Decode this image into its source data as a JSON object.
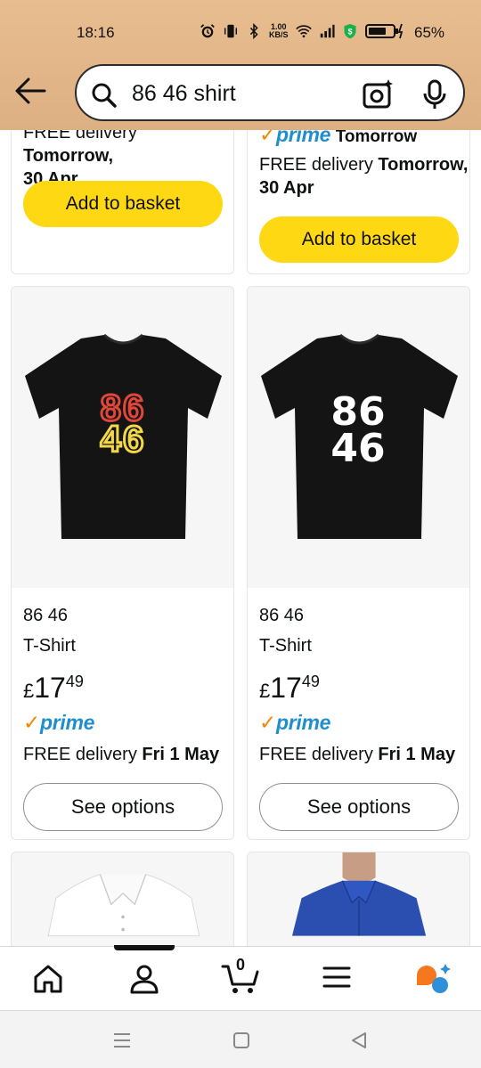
{
  "status_bar": {
    "time": "18:16",
    "network_speed_value": "1.00",
    "network_speed_unit": "KB/S",
    "battery": "65%"
  },
  "search": {
    "query": "86 46 shirt"
  },
  "cards_top": [
    {
      "delivery_prefix": "FREE delivery",
      "delivery_day": "Tomorrow,",
      "delivery_date": "30 Apr",
      "button": "Add to basket"
    },
    {
      "prime_label": "prime",
      "prime_delivery": "Tomorrow",
      "delivery_prefix": "FREE delivery",
      "delivery_day": "Tomorrow,",
      "delivery_date": "30 Apr",
      "button": "Add to basket"
    }
  ],
  "products": [
    {
      "title_line1": "86 46",
      "title_line2": "T-Shirt",
      "price_currency": "£",
      "price_whole": "17",
      "price_fraction": "49",
      "prime_label": "prime",
      "delivery_prefix": "FREE delivery",
      "delivery_date": "Fri 1 May",
      "button": "See options",
      "shirt_print_line1": "86",
      "shirt_print_line2": "46"
    },
    {
      "title_line1": "86 46",
      "title_line2": "T-Shirt",
      "price_currency": "£",
      "price_whole": "17",
      "price_fraction": "49",
      "prime_label": "prime",
      "delivery_prefix": "FREE delivery",
      "delivery_date": "Fri 1 May",
      "button": "See options",
      "shirt_print_line1": "86",
      "shirt_print_line2": "46"
    }
  ],
  "bottom_nav": {
    "cart_count": "0",
    "items": [
      "home-icon",
      "account-icon",
      "cart-icon",
      "menu-icon",
      "rufus-icon"
    ]
  },
  "colors": {
    "header_bg": "#e8bd8f",
    "basket_button": "#ffd814",
    "prime_blue": "#1f8ece",
    "prime_check": "#f08804"
  }
}
